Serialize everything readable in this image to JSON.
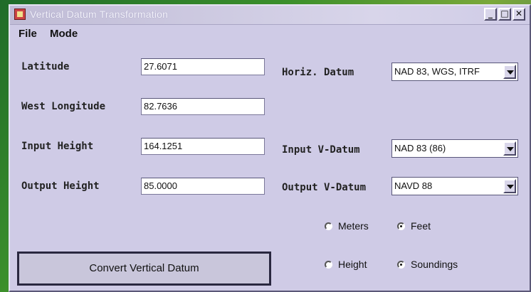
{
  "window": {
    "title": "Vertical Datum Transformation"
  },
  "menu": {
    "file": "File",
    "mode": "Mode"
  },
  "form": {
    "latitude_label": "Latitude",
    "latitude_value": "27.6071",
    "west_longitude_label": "West Longitude",
    "west_longitude_value": "82.7636",
    "input_height_label": "Input Height",
    "input_height_value": "164.1251",
    "output_height_label": "Output Height",
    "output_height_value": "85.0000",
    "horiz_datum_label": "Horiz. Datum",
    "horiz_datum_value": "NAD 83, WGS, ITRF",
    "input_vdatum_label": "Input V-Datum",
    "input_vdatum_value": "NAD 83 (86)",
    "output_vdatum_label": "Output V-Datum",
    "output_vdatum_value": "NAVD 88"
  },
  "units": {
    "meters": "Meters",
    "feet": "Feet",
    "selected": "Feet"
  },
  "mode_options": {
    "height": "Height",
    "soundings": "Soundings",
    "selected": "Soundings"
  },
  "buttons": {
    "convert": "Convert Vertical Datum"
  }
}
